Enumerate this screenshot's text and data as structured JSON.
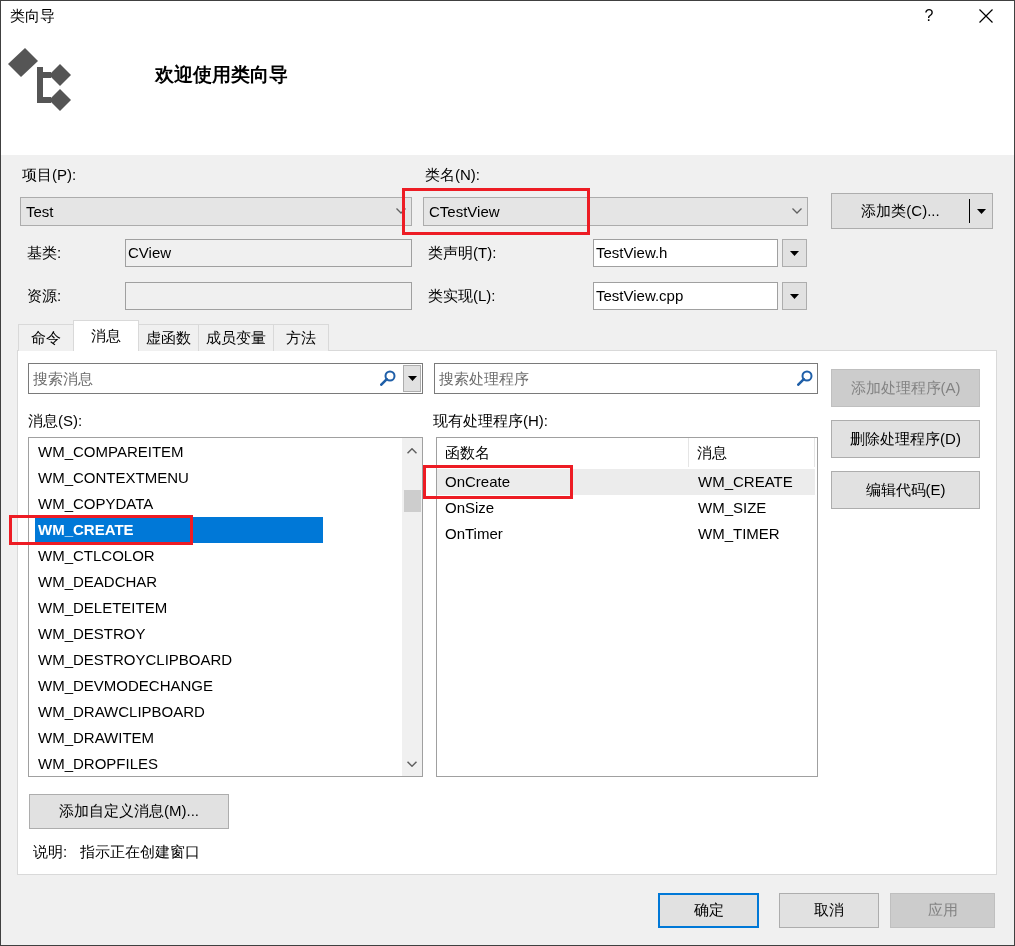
{
  "window": {
    "title": "类向导",
    "help": "?"
  },
  "header": {
    "title": "欢迎使用类向导"
  },
  "form": {
    "project": {
      "label": "项目(P):",
      "value": "Test",
      "highlighted": false
    },
    "class_name": {
      "label": "类名(N):",
      "value": "CTestView",
      "highlighted": true
    },
    "add_class_button": {
      "label": "添加类(C)..."
    },
    "base_class": {
      "label": "基类:",
      "value": "CView",
      "readonly": true
    },
    "class_declaration": {
      "label": "类声明(T):",
      "value": "TestView.h",
      "readonly": false
    },
    "resource": {
      "label": "资源:",
      "readonly": true
    },
    "class_implementation": {
      "label": "类实现(L):",
      "value": "TestView.cpp",
      "readonly": false
    }
  },
  "tabs": [
    {
      "label": "命令",
      "selected": false
    },
    {
      "label": "消息",
      "selected": true
    },
    {
      "label": "虚函数",
      "selected": false
    },
    {
      "label": "成员变量",
      "selected": false
    },
    {
      "label": "方法",
      "selected": false
    }
  ],
  "messages_panel": {
    "search": {
      "placeholder": "搜索消息"
    },
    "label": "消息(S):",
    "items": [
      {
        "label": "WM_COMPAREITEM",
        "selected": false,
        "highlighted": false
      },
      {
        "label": "WM_CONTEXTMENU",
        "selected": false,
        "highlighted": false
      },
      {
        "label": "WM_COPYDATA",
        "selected": false,
        "highlighted": false
      },
      {
        "label": "WM_CREATE",
        "selected": true,
        "highlighted": true
      },
      {
        "label": "WM_CTLCOLOR",
        "selected": false,
        "highlighted": false
      },
      {
        "label": "WM_DEADCHAR",
        "selected": false,
        "highlighted": false
      },
      {
        "label": "WM_DELETEITEM",
        "selected": false,
        "highlighted": false
      },
      {
        "label": "WM_DESTROY",
        "selected": false,
        "highlighted": false
      },
      {
        "label": "WM_DESTROYCLIPBOARD",
        "selected": false,
        "highlighted": false
      },
      {
        "label": "WM_DEVMODECHANGE",
        "selected": false,
        "highlighted": false
      },
      {
        "label": "WM_DRAWCLIPBOARD",
        "selected": false,
        "highlighted": false
      },
      {
        "label": "WM_DRAWITEM",
        "selected": false,
        "highlighted": false
      },
      {
        "label": "WM_DROPFILES",
        "selected": false,
        "highlighted": false
      }
    ],
    "add_custom_button": "添加自定义消息(M)...",
    "description_label": "说明:",
    "description": "指示正在创建窗口"
  },
  "handlers_panel": {
    "search": {
      "placeholder": "搜索处理程序"
    },
    "label": "现有处理程序(H):",
    "columns": [
      "函数名",
      "消息"
    ],
    "rows": [
      {
        "cells": [
          "OnCreate",
          "WM_CREATE"
        ],
        "selected": true,
        "highlighted": true
      },
      {
        "cells": [
          "OnSize",
          "WM_SIZE"
        ],
        "selected": false,
        "highlighted": false
      },
      {
        "cells": [
          "OnTimer",
          "WM_TIMER"
        ],
        "selected": false,
        "highlighted": false
      }
    ]
  },
  "side_buttons": [
    {
      "label": "添加处理程序(A)",
      "disabled": true
    },
    {
      "label": "删除处理程序(D)",
      "disabled": false
    },
    {
      "label": "编辑代码(E)",
      "disabled": false
    }
  ],
  "dialog_buttons": [
    {
      "label": "确定",
      "default": true,
      "disabled": false
    },
    {
      "label": "取消",
      "default": false,
      "disabled": false
    },
    {
      "label": "应用",
      "default": false,
      "disabled": true
    }
  ]
}
